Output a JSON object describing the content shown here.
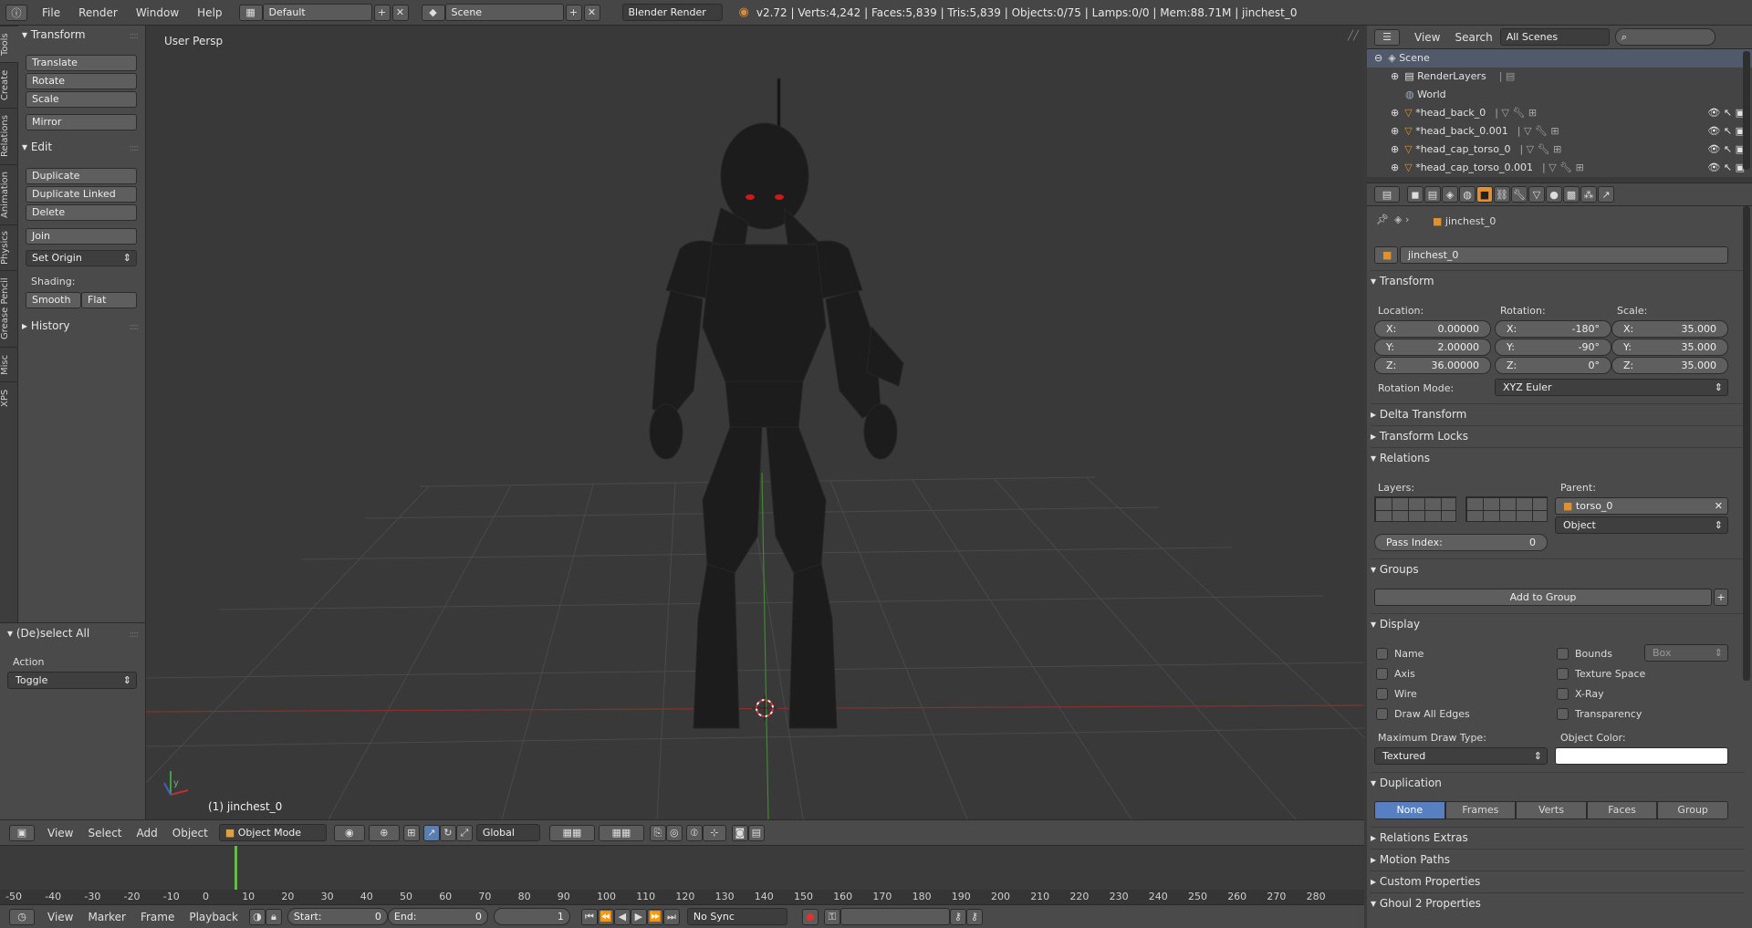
{
  "topbar": {
    "menus": [
      "File",
      "Render",
      "Window",
      "Help"
    ],
    "layout": "Default",
    "scene": "Scene",
    "engine": "Blender Render",
    "stats": "v2.72 | Verts:4,242 | Faces:5,839 | Tris:5,839 | Objects:0/75 | Lamps:0/0 | Mem:88.71M | jinchest_0"
  },
  "vtabs": [
    "Tools",
    "Create",
    "Relations",
    "Animation",
    "Physics",
    "Grease Pencil",
    "Misc",
    "XPS"
  ],
  "toolshelf": {
    "transform_title": "Transform",
    "transform_buttons": [
      "Translate",
      "Rotate",
      "Scale"
    ],
    "mirror": "Mirror",
    "edit_title": "Edit",
    "edit_buttons": [
      "Duplicate",
      "Duplicate Linked",
      "Delete"
    ],
    "join": "Join",
    "set_origin": "Set Origin",
    "shading_label": "Shading:",
    "smooth": "Smooth",
    "flat": "Flat",
    "history": "History",
    "op_title": "(De)select All",
    "action_label": "Action",
    "action_value": "Toggle"
  },
  "viewport": {
    "persp_label": "User Persp",
    "object_label": "(1) jinchest_0"
  },
  "vp_header": {
    "menus": [
      "View",
      "Select",
      "Add",
      "Object"
    ],
    "mode": "Object Mode",
    "orientation": "Global"
  },
  "timeline": {
    "ticks": [
      "-50",
      "-40",
      "-30",
      "-20",
      "-10",
      "0",
      "10",
      "20",
      "30",
      "40",
      "50",
      "60",
      "70",
      "80",
      "90",
      "100",
      "110",
      "120",
      "130",
      "140",
      "150",
      "160",
      "170",
      "180",
      "190",
      "200",
      "210",
      "220",
      "230",
      "240",
      "250",
      "260",
      "270",
      "280"
    ],
    "menus": [
      "View",
      "Marker",
      "Frame",
      "Playback"
    ],
    "start_label": "Start:",
    "start_value": "0",
    "end_label": "End:",
    "end_value": "0",
    "current": "1",
    "sync": "No Sync"
  },
  "outliner": {
    "menus": [
      "View",
      "Search"
    ],
    "scope": "All Scenes",
    "rows": [
      "Scene",
      "RenderLayers",
      "World",
      "*head_back_0",
      "*head_back_0.001",
      "*head_cap_torso_0",
      "*head_cap_torso_0.001"
    ]
  },
  "props": {
    "breadcrumb": "jinchest_0",
    "name": "jinchest_0",
    "transform_title": "Transform",
    "location_label": "Location:",
    "rotation_label": "Rotation:",
    "scale_label": "Scale:",
    "location": [
      {
        "k": "X:",
        "v": "0.00000"
      },
      {
        "k": "Y:",
        "v": "2.00000"
      },
      {
        "k": "Z:",
        "v": "36.00000"
      }
    ],
    "rotation": [
      {
        "k": "X:",
        "v": "-180°"
      },
      {
        "k": "Y:",
        "v": "-90°"
      },
      {
        "k": "Z:",
        "v": "0°"
      }
    ],
    "scale": [
      {
        "k": "X:",
        "v": "35.000"
      },
      {
        "k": "Y:",
        "v": "35.000"
      },
      {
        "k": "Z:",
        "v": "35.000"
      }
    ],
    "rotation_mode_label": "Rotation Mode:",
    "rotation_mode": "XYZ Euler",
    "delta": "Delta Transform",
    "locks": "Transform Locks",
    "relations": "Relations",
    "layers_label": "Layers:",
    "parent_label": "Parent:",
    "parent": "torso_0",
    "parent_type": "Object",
    "pass_index_label": "Pass Index:",
    "pass_index": "0",
    "groups": "Groups",
    "add_to_group": "Add to Group",
    "display": "Display",
    "name_chk": "Name",
    "axis_chk": "Axis",
    "wire_chk": "Wire",
    "edges_chk": "Draw All Edges",
    "bounds_chk": "Bounds",
    "bounds_type": "Box",
    "texspace_chk": "Texture Space",
    "xray_chk": "X-Ray",
    "transp_chk": "Transparency",
    "max_draw_label": "Maximum Draw Type:",
    "max_draw": "Textured",
    "obj_color_label": "Object Color:",
    "duplication": "Duplication",
    "dup_options": [
      "None",
      "Frames",
      "Verts",
      "Faces",
      "Group"
    ],
    "relations_extras": "Relations Extras",
    "motion_paths": "Motion Paths",
    "custom_props": "Custom Properties",
    "ghoul": "Ghoul 2 Properties"
  }
}
